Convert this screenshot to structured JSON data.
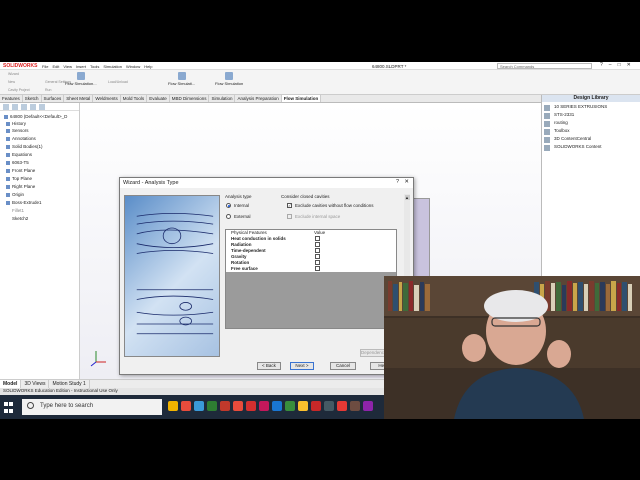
{
  "titlebar": {
    "logo": "SOLIDWORKS",
    "menus": [
      "File",
      "Edit",
      "View",
      "Insert",
      "Tools",
      "Simulation",
      "Window",
      "Help"
    ],
    "document": "64800.SLDPRT *",
    "search_placeholder": "Search Commands",
    "controls": [
      "?",
      "–",
      "□",
      "✕"
    ]
  },
  "command_manager": {
    "small_items": [
      "Wizard",
      "New",
      "Cavity Project",
      "General Settings",
      "Run",
      "Load/Unload",
      "Flow Simulation"
    ],
    "buttons": [
      "Flow Simulation...",
      "Flow Simulati..."
    ]
  },
  "tabs": [
    "Features",
    "Sketch",
    "Surfaces",
    "Sheet Metal",
    "Weldments",
    "Mold Tools",
    "Evaluate",
    "MBD Dimensions",
    "Simulation",
    "Analysis Preparation",
    "Flow Simulation"
  ],
  "active_tab": "Flow Simulation",
  "feature_tree": [
    "64800 (Default<<Default>_D",
    "History",
    "Sensors",
    "Annotations",
    "Solid Bodies(1)",
    "Equations",
    "6063-T5",
    "Front Plane",
    "Top Plane",
    "Right Plane",
    "Origin",
    "Boss-Extrude1",
    "Fillet1",
    "Sketch2"
  ],
  "design_library": {
    "title": "Design Library",
    "items": [
      "10 SERIES EXTRUSIONS",
      "STS-2331",
      "routing",
      "Toolbox",
      "3D ContentCentral",
      "SOLIDWORKS Content"
    ]
  },
  "bottom_tabs": [
    "Model",
    "3D Views",
    "Motion Study 1"
  ],
  "status_bar": "SOLIDWORKS Education Edition - Instructional Use Only",
  "taskbar": {
    "search_text": "Type here to search",
    "app_colors": [
      "#f2b400",
      "#e74c3c",
      "#3a9ad9",
      "#2e7d32",
      "#c0392b",
      "#e74c3c",
      "#d32f2f",
      "#c2185b",
      "#1976d2",
      "#388e3c",
      "#fbc02d",
      "#c62828",
      "#455a64",
      "#e53935",
      "#6d4c41",
      "#8e24aa"
    ]
  },
  "wizard": {
    "title": "Wizard - Analysis Type",
    "help": "?",
    "close": "✕",
    "analysis_type_label": "Analysis type",
    "internal": "Internal",
    "external": "External",
    "cavities_label": "Consider closed cavities",
    "exclude_cavities": "Exclude cavities without flow conditions",
    "exclude_internal": "Exclude internal space",
    "col_features": "Physical Features",
    "col_value": "Value",
    "features": [
      "Heat conduction in solids",
      "Radiation",
      "Time-dependent",
      "Gravity",
      "Rotation",
      "Free surface"
    ],
    "dependency": "Dependency...",
    "back": "< Back",
    "next": "Next >",
    "cancel": "Cancel",
    "help_btn": "Help"
  }
}
